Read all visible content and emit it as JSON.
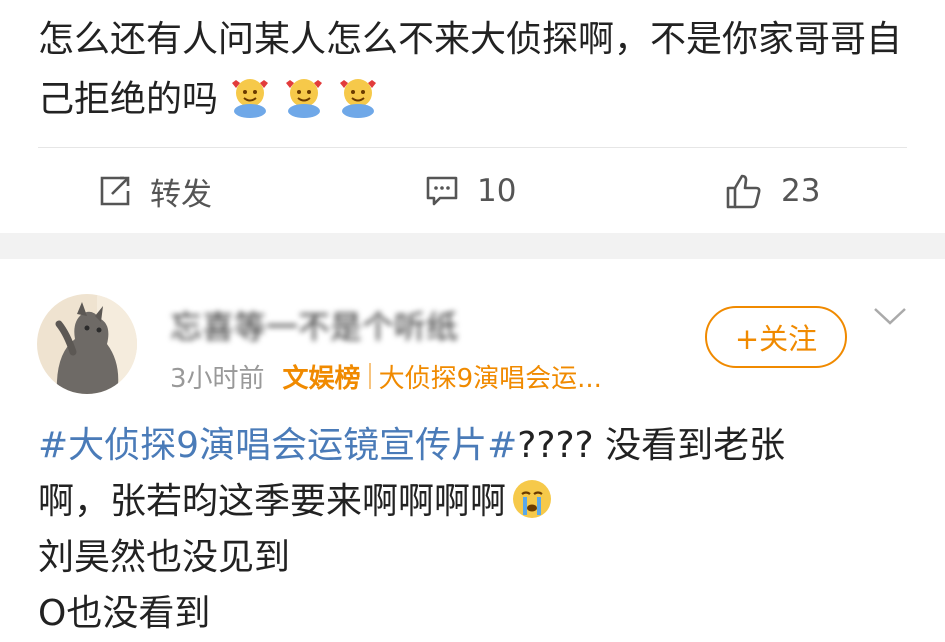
{
  "post": {
    "text": "怎么还有人问某人怎么不来大侦探啊，不是你家哥哥自己拒绝的吗",
    "emojis": [
      "hug-emoji",
      "hug-emoji",
      "hug-emoji"
    ]
  },
  "actions": {
    "repost_label": "转发",
    "comment_count": "10",
    "like_count": "23"
  },
  "comment": {
    "username": "忘喜等一不是个听纸",
    "time": "3小时前",
    "source_tag": "文娱榜",
    "topic": "大侦探9演唱会运...",
    "follow_label": "+关注",
    "hashtag": "#大侦探9演唱会运镜宣传片#",
    "line1_rest": "????  没看到老张",
    "line2": "啊，张若昀这季要来啊啊啊啊",
    "line2_emoji": "crying-emoji",
    "line3": "刘昊然也没见到",
    "line4": "O也没看到"
  },
  "colors": {
    "accent": "#f08a00",
    "hashtag": "#4a7bb8",
    "muted": "#999999"
  }
}
